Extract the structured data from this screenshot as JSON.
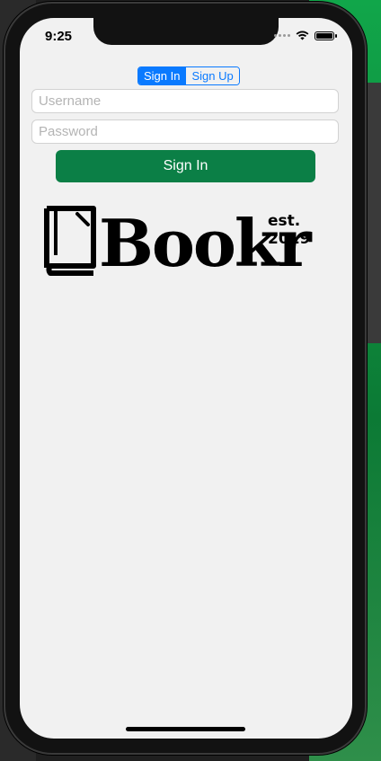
{
  "status_bar": {
    "time": "9:25"
  },
  "auth": {
    "segments": [
      "Sign In",
      "Sign Up"
    ],
    "selected_segment": "Sign In",
    "username_placeholder": "Username",
    "password_placeholder": "Password",
    "submit_label": "Sign In"
  },
  "logo": {
    "wordmark": "Bookr",
    "tagline": "est. 2019",
    "icon": "book-icon"
  },
  "colors": {
    "accent": "#0a7aff",
    "button": "#0b7f46",
    "screen_bg": "#f1f1f1"
  }
}
